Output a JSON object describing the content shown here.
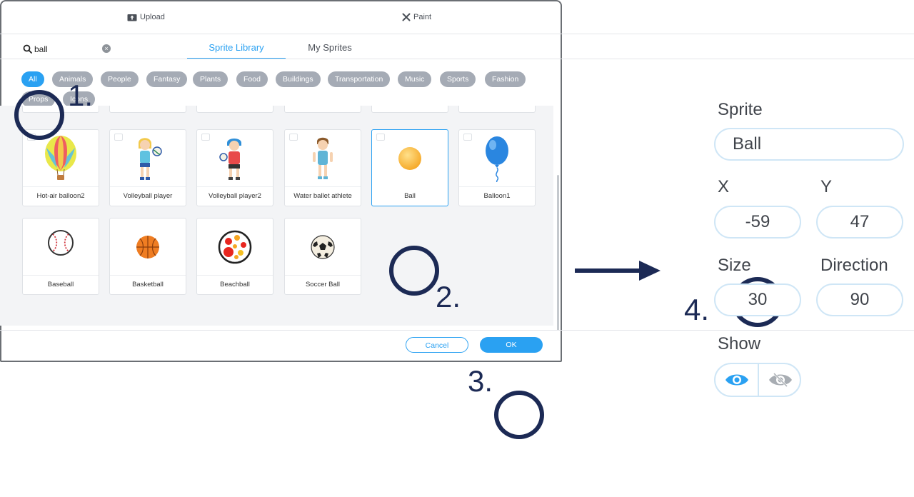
{
  "dialog": {
    "upload_label": "Upload",
    "paint_label": "Paint",
    "search": {
      "value": "ball",
      "placeholder": ""
    },
    "tabs": [
      {
        "label": "Sprite Library",
        "active": true
      },
      {
        "label": "My Sprites",
        "active": false
      }
    ],
    "categories": [
      "All",
      "Animals",
      "People",
      "Fantasy",
      "Plants",
      "Food",
      "Buildings",
      "Transportation",
      "Music",
      "Sports",
      "Fashion",
      "Props",
      "Icons"
    ],
    "active_category": "All",
    "sprites": [
      {
        "label": "Hot-air balloon2",
        "icon": "hot-air-balloon-icon"
      },
      {
        "label": "Volleyball player",
        "icon": "volleyball-player-icon"
      },
      {
        "label": "Volleyball player2",
        "icon": "volleyball-player2-icon"
      },
      {
        "label": "Water ballet athlete",
        "icon": "water-ballet-athlete-icon"
      },
      {
        "label": "Ball",
        "icon": "ball-icon",
        "selected": true
      },
      {
        "label": "Balloon1",
        "icon": "balloon-icon"
      },
      {
        "label": "Baseball",
        "icon": "baseball-icon"
      },
      {
        "label": "Basketball",
        "icon": "basketball-icon"
      },
      {
        "label": "Beachball",
        "icon": "beachball-icon"
      },
      {
        "label": "Soccer Ball",
        "icon": "soccer-ball-icon"
      }
    ],
    "cancel_label": "Cancel",
    "ok_label": "OK"
  },
  "steps": {
    "s1": "1.",
    "s2": "2.",
    "s3": "3.",
    "s4": "4."
  },
  "properties": {
    "sprite_label": "Sprite",
    "sprite_name": "Ball",
    "x_label": "X",
    "x_value": "-59",
    "y_label": "Y",
    "y_value": "47",
    "size_label": "Size",
    "size_value": "30",
    "direction_label": "Direction",
    "direction_value": "90",
    "show_label": "Show",
    "show_visible": true
  },
  "colors": {
    "accent": "#2aa1f2",
    "annotation": "#1c2a55",
    "chip": "#a5abb5"
  }
}
